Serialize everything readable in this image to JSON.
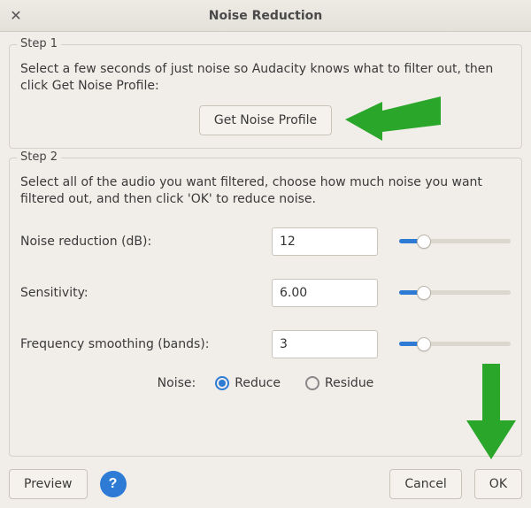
{
  "window": {
    "title": "Noise Reduction",
    "close_glyph": "✕"
  },
  "step1": {
    "label": "Step 1",
    "instruction": "Select a few seconds of just noise so Audacity knows what to filter out, then click Get Noise Profile:",
    "button": "Get Noise Profile"
  },
  "step2": {
    "label": "Step 2",
    "instruction": "Select all of the audio you want filtered, choose how much noise you want filtered out, and then click 'OK' to reduce noise.",
    "params": {
      "noise_reduction": {
        "label": "Noise reduction (dB):",
        "value": "12",
        "slider_pct": 22
      },
      "sensitivity": {
        "label": "Sensitivity:",
        "value": "6.00",
        "slider_pct": 22
      },
      "frequency_smoothing": {
        "label": "Frequency smoothing (bands):",
        "value": "3",
        "slider_pct": 22
      }
    },
    "noise_label": "Noise:",
    "radio": {
      "reduce": "Reduce",
      "residue": "Residue",
      "selected": "reduce"
    }
  },
  "buttons": {
    "preview": "Preview",
    "help": "?",
    "cancel": "Cancel",
    "ok": "OK"
  },
  "annotations": {
    "arrow_color": "#2aa62a"
  }
}
